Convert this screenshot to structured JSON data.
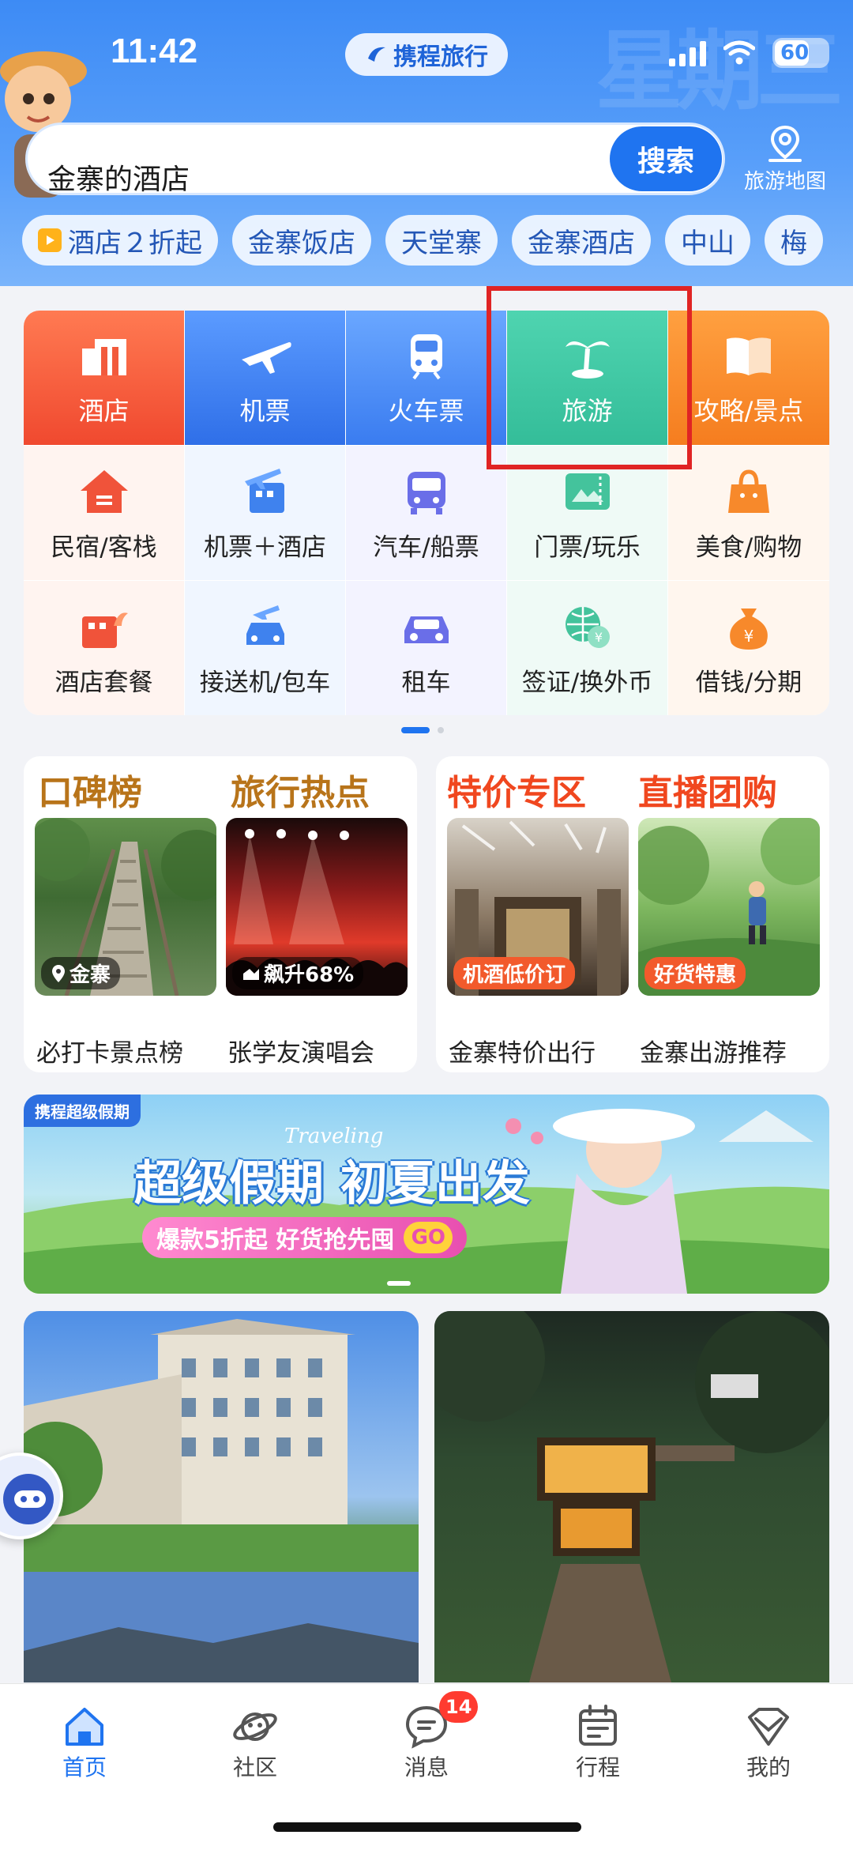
{
  "status_bar": {
    "time": "11:42",
    "battery": "60"
  },
  "brand": {
    "name": "携程旅行"
  },
  "watermark": "星期三",
  "search": {
    "value": "金寨的酒店",
    "button": "搜索"
  },
  "map_button": {
    "label": "旅游地图"
  },
  "chips": [
    {
      "label": "酒店２折起",
      "icon": "play-icon"
    },
    {
      "label": "金寨饭店"
    },
    {
      "label": "天堂寨"
    },
    {
      "label": "金寨酒店"
    },
    {
      "label": "中山"
    },
    {
      "label": "梅"
    }
  ],
  "main_tiles": [
    {
      "label": "酒店",
      "icon": "hotel-icon",
      "color": "#f25a3c"
    },
    {
      "label": "机票",
      "icon": "airplane-icon",
      "color": "#3d7ef2"
    },
    {
      "label": "火车票",
      "icon": "train-icon",
      "color": "#4a86f0"
    },
    {
      "label": "旅游",
      "icon": "palm-tree-icon",
      "color": "#3dc4a0"
    },
    {
      "label": "攻略/景点",
      "icon": "book-icon",
      "color": "#f78a2a"
    }
  ],
  "sub_tiles": [
    {
      "label": "民宿/客栈",
      "icon": "house-icon"
    },
    {
      "label": "机票＋酒店",
      "icon": "flight-hotel-icon"
    },
    {
      "label": "汽车/船票",
      "icon": "bus-icon"
    },
    {
      "label": "门票/玩乐",
      "icon": "ticket-icon"
    },
    {
      "label": "美食/购物",
      "icon": "shopping-bag-icon"
    },
    {
      "label": "酒店套餐",
      "icon": "hotel-package-icon"
    },
    {
      "label": "接送机/包车",
      "icon": "car-transfer-icon"
    },
    {
      "label": "租车",
      "icon": "car-icon"
    },
    {
      "label": "签证/换外币",
      "icon": "visa-currency-icon"
    },
    {
      "label": "借钱/分期",
      "icon": "money-bag-icon"
    }
  ],
  "cards": {
    "left": {
      "title1": "口碑榜",
      "title2": "旅行热点",
      "items": [
        {
          "tag": "金寨",
          "caption": "必打卡景点榜"
        },
        {
          "tag": "飙升68%",
          "caption": "张学友演唱会"
        }
      ]
    },
    "right": {
      "title1": "特价专区",
      "title2": "直播团购",
      "items": [
        {
          "tag": "机酒低价订",
          "caption": "金寨特价出行"
        },
        {
          "tag": "好货特惠",
          "caption": "金寨出游推荐"
        }
      ]
    }
  },
  "banner": {
    "corner": "携程超级假期",
    "script": "Traveling",
    "headline": "超级假期 初夏出发",
    "sub": "爆款5折起 好货抢先囤",
    "go": "GO"
  },
  "nav": [
    {
      "label": "首页",
      "icon": "home-icon",
      "active": true
    },
    {
      "label": "社区",
      "icon": "planet-icon"
    },
    {
      "label": "消息",
      "icon": "message-icon",
      "badge": "14"
    },
    {
      "label": "行程",
      "icon": "calendar-icon"
    },
    {
      "label": "我的",
      "icon": "diamond-icon"
    }
  ],
  "colors": {
    "accent": "#1f74f0",
    "highlight": "#e02424",
    "gold": "#b8741a"
  }
}
